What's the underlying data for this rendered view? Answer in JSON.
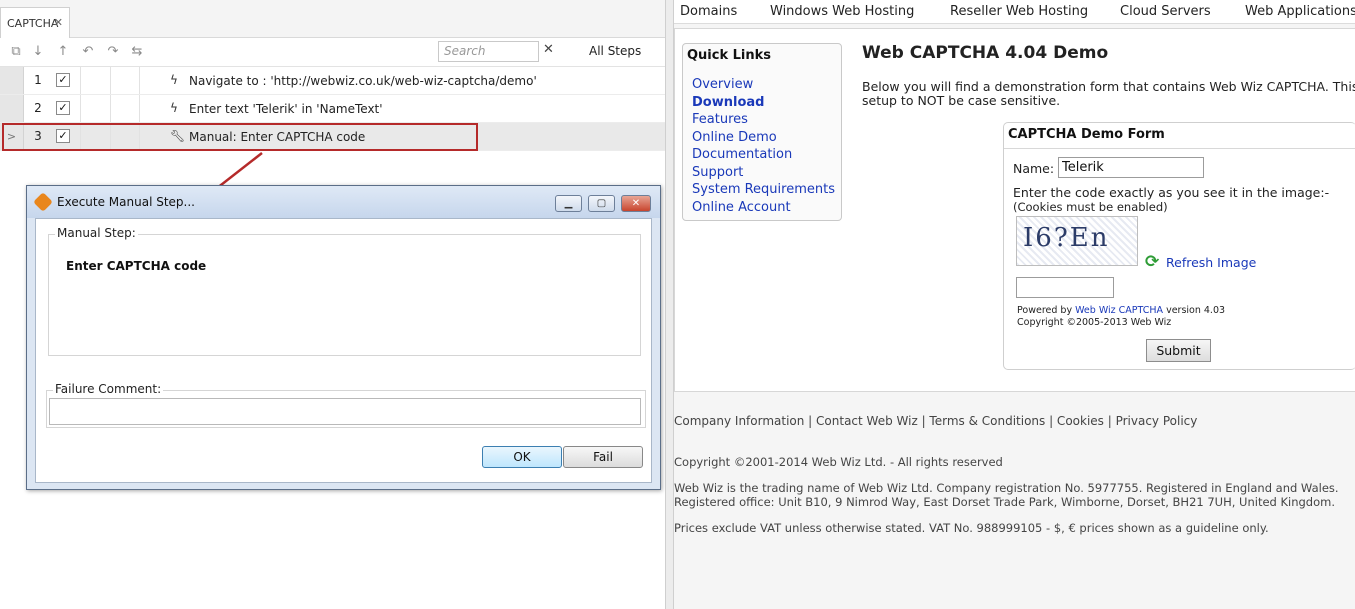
{
  "left": {
    "tab": {
      "label": "CAPTCHA",
      "close": "✕"
    },
    "toolbar": {
      "search_placeholder": "Search",
      "clear": "✕",
      "filter_label": "All Steps"
    },
    "steps": [
      {
        "num": "1",
        "checked": "✓",
        "icon": "lightning-icon",
        "text": "Navigate to : 'http://webwiz.co.uk/web-wiz-captcha/demo'"
      },
      {
        "num": "2",
        "checked": "✓",
        "icon": "lightning-icon",
        "text": "Enter text 'Telerik' in 'NameText'"
      },
      {
        "num": "3",
        "checked": "✓",
        "icon": "wrench-icon",
        "text": "Manual: Enter CAPTCHA code",
        "selected": true,
        "handle": ">"
      }
    ]
  },
  "dialog": {
    "title": "Execute Manual Step...",
    "manual_step_label": "Manual Step:",
    "manual_step_text": "Enter CAPTCHA code",
    "failure_comment_label": "Failure Comment:",
    "failure_comment_value": "",
    "ok_label": "OK",
    "fail_label": "Fail"
  },
  "web": {
    "nav": [
      "Domains",
      "Windows Web Hosting",
      "Reseller Web Hosting",
      "Cloud Servers",
      "Web Applications"
    ],
    "quick_links_title": "Quick Links",
    "quick_links": [
      {
        "label": "Overview",
        "bold": false
      },
      {
        "label": "Download",
        "bold": true
      },
      {
        "label": "Features",
        "bold": false
      },
      {
        "label": "Online Demo",
        "bold": false
      },
      {
        "label": "Documentation",
        "bold": false
      },
      {
        "label": "Support",
        "bold": false
      },
      {
        "label": "System Requirements",
        "bold": false
      },
      {
        "label": "Online Account",
        "bold": false
      }
    ],
    "page_title": "Web CAPTCHA 4.04 Demo",
    "intro_line1": "Below you will find a demonstration form that contains Web Wiz CAPTCHA. This d",
    "intro_line2": "setup to NOT be case sensitive.",
    "form": {
      "title": "CAPTCHA Demo Form",
      "name_label": "Name:",
      "name_value": "Telerik",
      "instruction": "Enter the code exactly as you see it in the image:-",
      "cookies_note": "(Cookies must be enabled)",
      "captcha_text": "I6?En",
      "refresh_label": "Refresh Image",
      "code_value": "",
      "powered_prefix": "Powered by",
      "powered_link": "Web Wiz CAPTCHA",
      "powered_suffix": "version 4.03",
      "copyright": "Copyright ©2005-2013 Web Wiz",
      "submit_label": "Submit"
    },
    "footer": {
      "links": "Company Information | Contact Web Wiz | Terms & Conditions | Cookies | Privacy Policy",
      "copyright": "Copyright ©2001-2014 Web Wiz Ltd. - All rights reserved",
      "trading1": "Web Wiz is the trading name of Web Wiz Ltd. Company registration No. 5977755. Registered in England and Wales.",
      "trading2": "Registered office: Unit B10, 9 Nimrod Way, East Dorset Trade Park, Wimborne, Dorset, BH21 7UH, United Kingdom.",
      "vat": "Prices exclude VAT unless otherwise stated. VAT No. 988999105 - $, € prices shown as a guideline only."
    }
  },
  "colors": {
    "highlight_border": "#b52a2a",
    "link_blue": "#1a39b9",
    "dialog_frame": "#dce6f3"
  }
}
